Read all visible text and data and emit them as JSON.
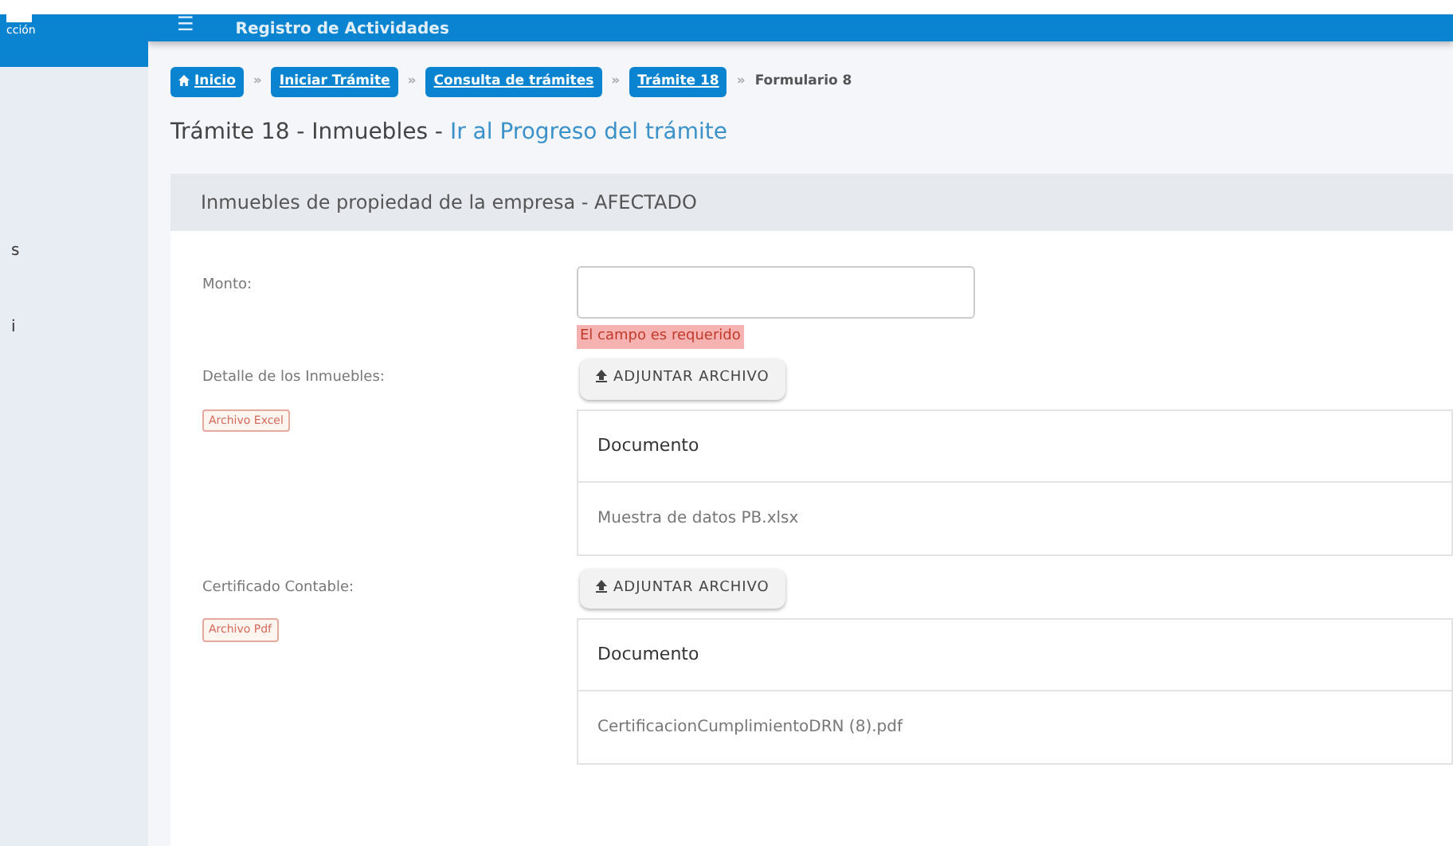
{
  "sidebar": {
    "logo_text": "cción",
    "items": [
      "s",
      "i"
    ]
  },
  "header": {
    "menu_icon": "☰",
    "title": "Registro de Actividades"
  },
  "breadcrumb": {
    "separator": "»",
    "items": [
      {
        "label": "Inicio",
        "kind": "home"
      },
      {
        "label": "Iniciar Trámite",
        "kind": "link"
      },
      {
        "label": "Consulta de trámites",
        "kind": "link"
      },
      {
        "label": "Trámite 18",
        "kind": "link"
      },
      {
        "label": "Formulario 8",
        "kind": "current"
      }
    ]
  },
  "page_title": {
    "text": "Trámite 18 - Inmuebles - ",
    "link": "Ir al Progreso del trámite"
  },
  "panel": {
    "title": "Inmuebles de propiedad de la empresa - AFECTADO",
    "fields": [
      {
        "kind": "input",
        "label": "Monto:",
        "error": "El campo es requerido"
      },
      {
        "kind": "file",
        "label": "Detalle de los Inmuebles:",
        "tag": "Archivo Excel",
        "button": "ADJUNTAR ARCHIVO",
        "column": "Documento",
        "files": [
          "Muestra de datos PB.xlsx"
        ]
      },
      {
        "kind": "file",
        "label": "Certificado Contable:",
        "tag": "Archivo Pdf",
        "button": "ADJUNTAR ARCHIVO",
        "column": "Documento",
        "files": [
          "CertificacionCumplimientoDRN (8).pdf"
        ]
      }
    ]
  }
}
